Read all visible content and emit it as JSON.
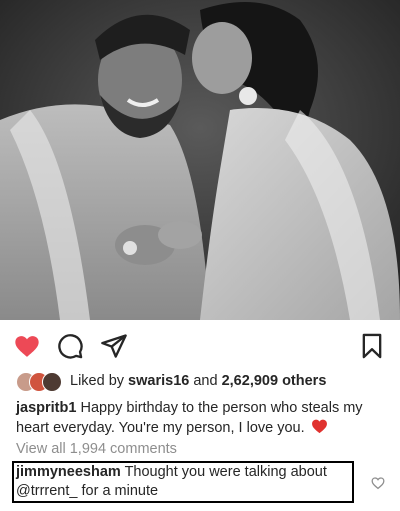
{
  "post": {
    "image_alt": "Black and white photo of a couple; woman kissing smiling man on the cheek"
  },
  "likes": {
    "prefix": "Liked by",
    "user": "swaris16",
    "connector": "and",
    "count": "2,62,909 others"
  },
  "caption": {
    "username": "jaspritb1",
    "text": "Happy birthday to the person who steals my heart everyday. You're my person, I love you."
  },
  "comments": {
    "view_all": "View all 1,994 comments"
  },
  "highlighted_comment": {
    "username": "jimmyneesham",
    "text": "Thought you were talking about",
    "mention": "@trrrent_",
    "text_end": "for a minute"
  },
  "colors": {
    "like_red": "#ed4956",
    "text": "#262626",
    "muted": "#8e8e8e"
  }
}
